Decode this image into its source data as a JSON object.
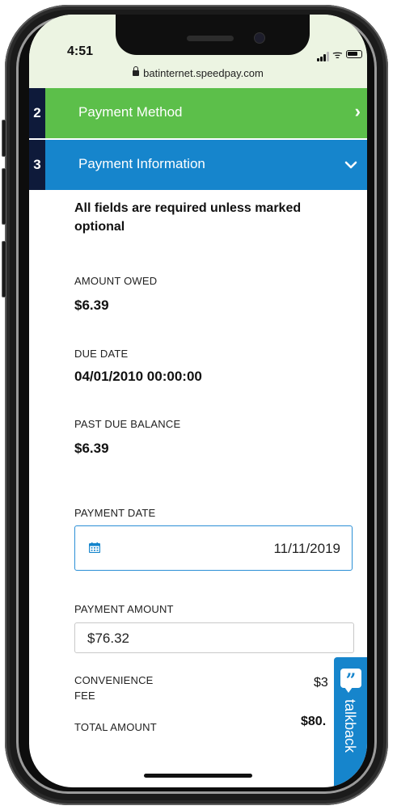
{
  "status_bar": {
    "time": "4:51",
    "url": "batinternet.speedpay.com"
  },
  "steps": [
    {
      "number": "2",
      "label": "Payment Method",
      "state": "collapsed",
      "color": "#5cbf4a"
    },
    {
      "number": "3",
      "label": "Payment Information",
      "state": "expanded",
      "color": "#1685cc"
    }
  ],
  "form": {
    "required_note": "All fields are required unless marked optional",
    "amount_owed": {
      "label": "AMOUNT OWED",
      "value": "$6.39"
    },
    "due_date": {
      "label": "DUE DATE",
      "value": "04/01/2010 00:00:00"
    },
    "past_due_balance": {
      "label": "PAST DUE BALANCE",
      "value": "$6.39"
    },
    "payment_date": {
      "label": "PAYMENT DATE",
      "value": "11/11/2019"
    },
    "payment_amount": {
      "label": "PAYMENT AMOUNT",
      "value": "$76.32"
    },
    "convenience_fee": {
      "label_line1": "CONVENIENCE",
      "label_line2": "FEE",
      "value": "$3"
    },
    "total_amount": {
      "label": "TOTAL AMOUNT",
      "value": "$80."
    }
  },
  "talkback": {
    "icon": "quote-icon",
    "label": "talkback"
  },
  "colors": {
    "accent_blue": "#1685cc",
    "accent_green": "#5cbf4a",
    "step_number_bg": "#0e1a3a",
    "statusbar_bg": "#ecf4e2"
  }
}
